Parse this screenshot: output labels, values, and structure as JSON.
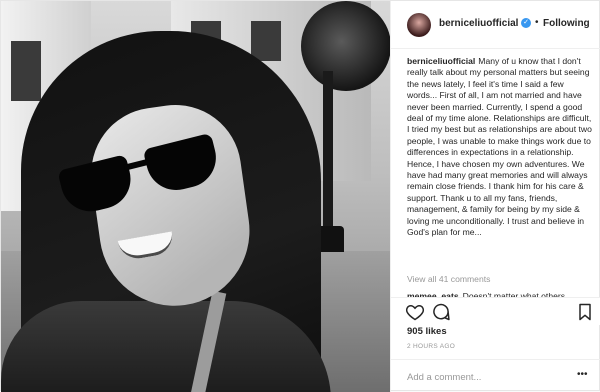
{
  "post": {
    "username": "berniceliuofficial",
    "follow_dot": "•",
    "follow_label": "Following",
    "caption_text": "Many of u know that I don't really talk about my personal matters but seeing the news lately, I feel it's time I said a few words... First of all, I am not married and have never been married. Currently, I spend a good deal of my time alone. Relationships are difficult, I tried my best but as relationships are about two people, I was unable to make things work due to differences in expectations in a relationship. Hence, I have chosen my own adventures. We have had many great memories and will always remain close friends. I thank him for his care & support. Thank u to all my fans, friends, management, & family for being by my side & loving me unconditionally. I trust and believe in God's plan for me...",
    "view_comments": "View all 41 comments",
    "comment": {
      "user": "memee_eats",
      "text": "Doesn't matter what others"
    },
    "likes": "905 likes",
    "time": "2 HOURS AGO",
    "add_comment_placeholder": "Add a comment...",
    "more_glyph": "•••",
    "verified_glyph": "✓"
  },
  "icons": [
    "heart-icon",
    "comment-icon",
    "bookmark-icon",
    "verified-icon",
    "more-icon"
  ]
}
